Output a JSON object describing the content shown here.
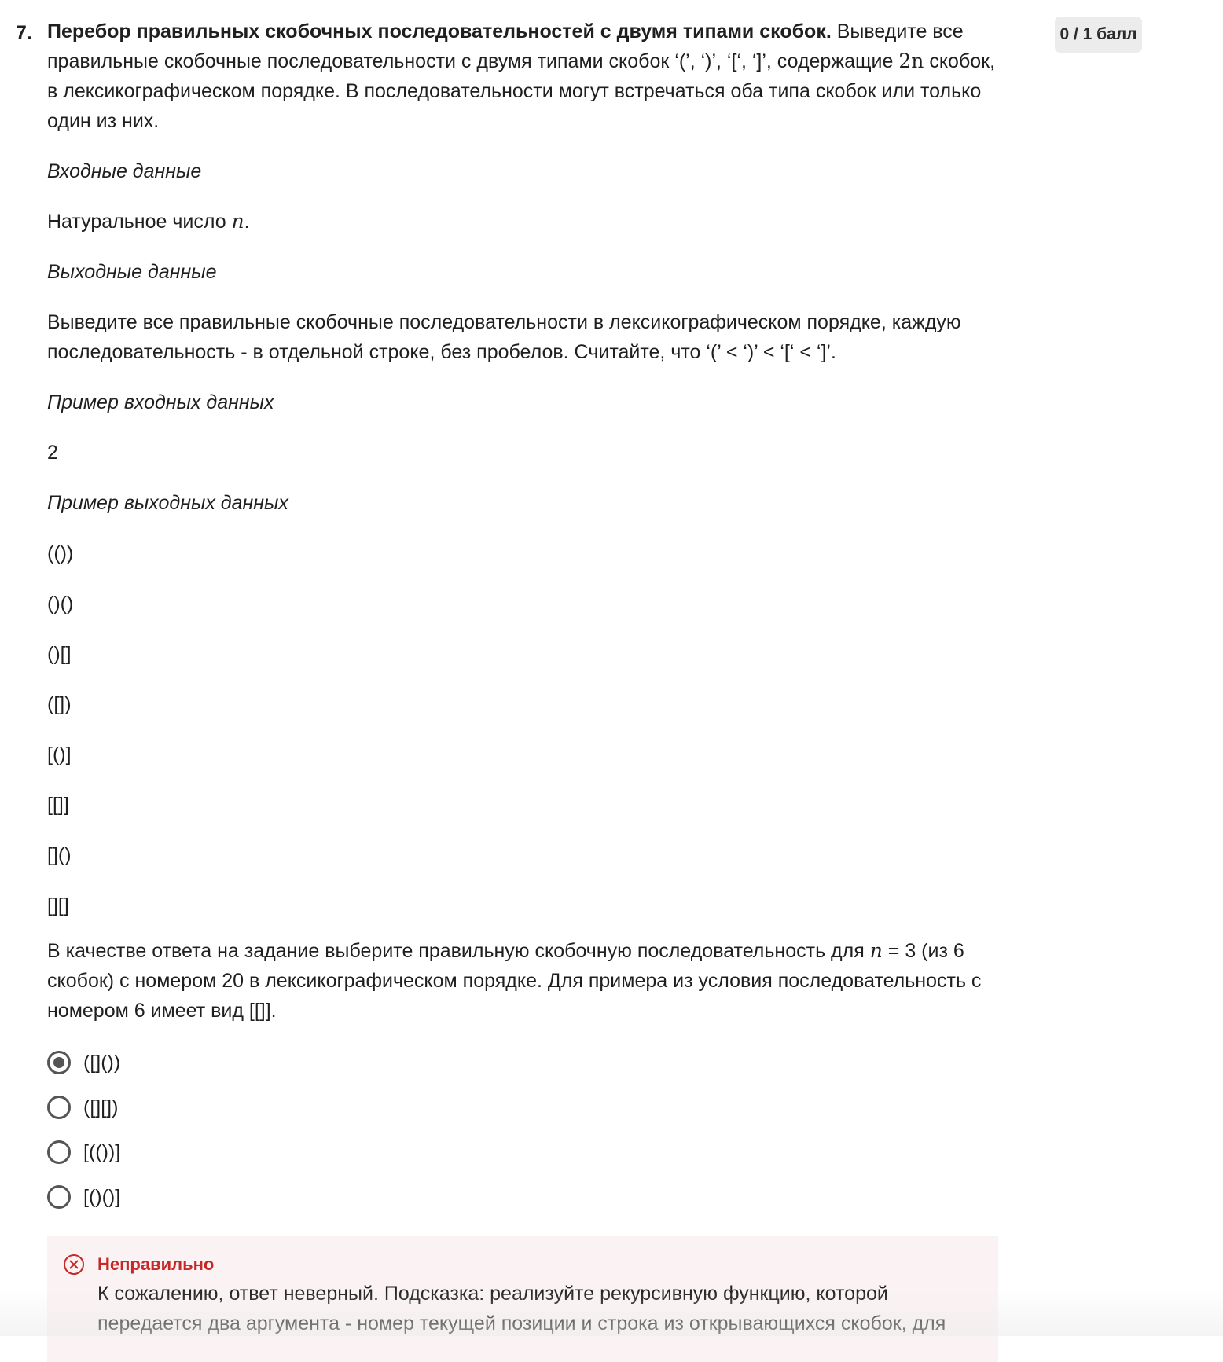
{
  "question": {
    "number": "7.",
    "score": "0 / 1 балл",
    "title": "Перебор правильных скобочных последовательностей с двумя типами скобок.",
    "intro_part1": " Выведите все правильные скобочные последовательности с двумя типами скобок ‘(’, ‘)’, ‘[‘, ‘]’, содержащие ",
    "intro_math": "2n",
    "intro_part2": " скобок, в лексикографическом порядке. В последовательности могут встречаться оба типа скобок или только один из них."
  },
  "input_section": {
    "heading": "Входные данные",
    "text_before": "Натуральное число ",
    "math": "n",
    "text_after": "."
  },
  "output_section": {
    "heading": "Выходные данные",
    "text": "Выведите все правильные скобочные последовательности в лексикографическом порядке, каждую последовательность - в отдельной строке, без пробелов. Считайте, что ‘(’ < ‘)’ < ‘[‘ < ‘]’."
  },
  "sample_input": {
    "heading": "Пример входных данных",
    "value": "2"
  },
  "sample_output": {
    "heading": "Пример выходных данных",
    "lines": [
      "(())",
      "()()",
      "()[]",
      "([])",
      "[()]",
      "[[]]",
      "[]()",
      "[][]"
    ]
  },
  "answer_task": {
    "part1": "В качестве ответа на задание выберите правильную скобочную последовательность для ",
    "math": "n",
    "part2": " = 3 (из 6 скобок) с номером 20 в лексикографическом порядке. Для примера из условия последовательность с номером 6 имеет вид [[]]."
  },
  "options": [
    {
      "label": "([]())",
      "checked": true
    },
    {
      "label": "([][])",
      "checked": false
    },
    {
      "label": "[(())]",
      "checked": false
    },
    {
      "label": "[()()]",
      "checked": false
    }
  ],
  "feedback": {
    "title": "Неправильно",
    "text": "К сожалению, ответ неверный. Подсказка: реализуйте рекурсивную функцию, которой передается два аргумента - номер текущей позиции и строка из открывающихся скобок, для",
    "icon": "x-circle-icon",
    "color": "#c62828"
  }
}
